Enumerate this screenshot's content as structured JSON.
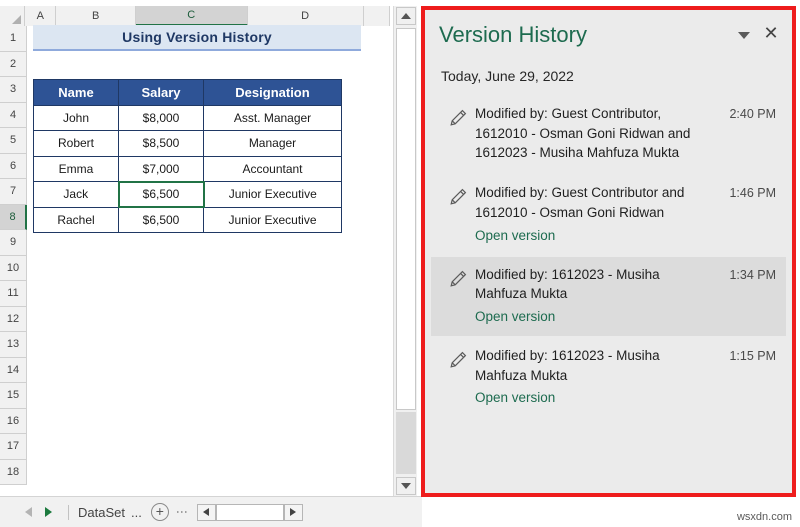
{
  "spreadsheet": {
    "column_headers": [
      "A",
      "B",
      "C",
      "D"
    ],
    "active_column": "C",
    "row_headers": [
      "1",
      "2",
      "3",
      "4",
      "5",
      "6",
      "7",
      "8",
      "9",
      "10",
      "11",
      "12",
      "13",
      "14",
      "15",
      "16",
      "17",
      "18"
    ],
    "active_row": "8",
    "title_cell": "Using Version History",
    "table": {
      "headers": [
        "Name",
        "Salary",
        "Designation"
      ],
      "rows": [
        [
          "John",
          "$8,000",
          "Asst. Manager"
        ],
        [
          "Robert",
          "$8,500",
          "Manager"
        ],
        [
          "Emma",
          "$7,000",
          "Accountant"
        ],
        [
          "Jack",
          "$6,500",
          "Junior Executive"
        ],
        [
          "Rachel",
          "$6,500",
          "Junior Executive"
        ]
      ],
      "active_cell": "$6,500"
    },
    "sheet_bar": {
      "prev_sheet_icon": "triangle-left-icon",
      "next_sheet_icon": "triangle-right-icon",
      "sheet_tab_name": "DataSet",
      "sheet_tab_ellipsis": "...",
      "add_sheet_label": "+",
      "kebab_label": "⋮"
    },
    "scrollbars": {
      "v_up_icon": "triangle-up-icon",
      "v_down_icon": "triangle-down-icon",
      "h_left_icon": "triangle-left-icon",
      "h_right_icon": "triangle-right-icon"
    }
  },
  "panel": {
    "title": "Version History",
    "collapse_icon": "chevron-down-icon",
    "close_label": "✕",
    "date_group": "Today, June 29, 2022",
    "accent_green": "#1d6b4f",
    "frame_color": "#ee1c1c",
    "highlight_color": "#dcdcdc",
    "versions": [
      {
        "icon": "pencil-icon",
        "text": "Modified by: Guest Contributor, 1612010 - Osman Goni Ridwan and 1612023 - Musiha Mahfuza Mukta",
        "time": "2:40 PM",
        "link": "",
        "highlighted": false
      },
      {
        "icon": "pencil-icon",
        "text": "Modified by: Guest Contributor and 1612010 - Osman Goni Ridwan",
        "time": "1:46 PM",
        "link": "Open version",
        "highlighted": false
      },
      {
        "icon": "pencil-icon",
        "text": "Modified by: 1612023 - Musiha Mahfuza Mukta",
        "time": "1:34 PM",
        "link": "Open version",
        "highlighted": true
      },
      {
        "icon": "pencil-icon",
        "text": "Modified by: 1612023 - Musiha Mahfuza Mukta",
        "time": "1:15 PM",
        "link": "Open version",
        "highlighted": false
      }
    ]
  },
  "watermark": "wsxdn.com"
}
